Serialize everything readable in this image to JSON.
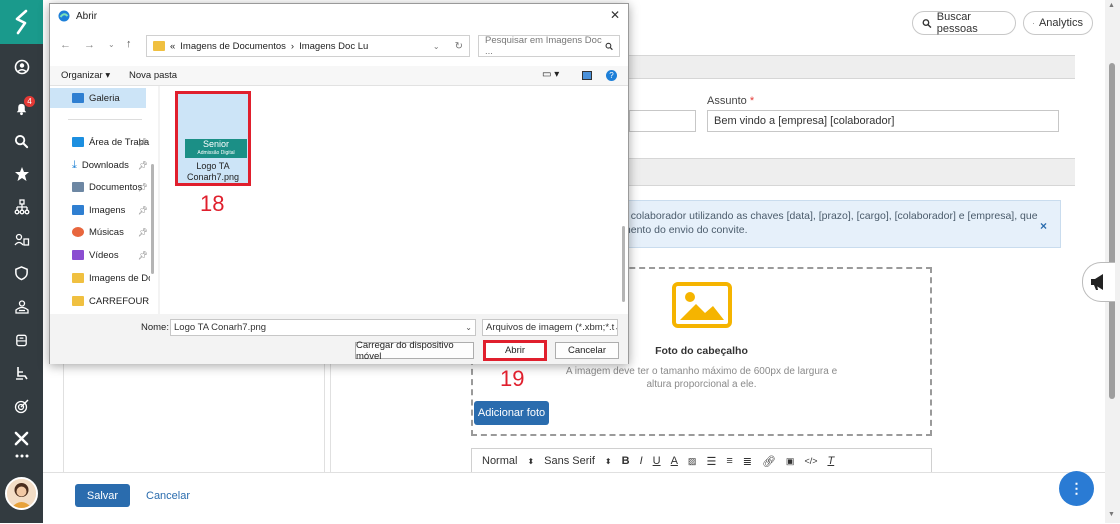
{
  "topbar": {
    "search_people": "Buscar pessoas",
    "analytics": "Analytics"
  },
  "sidebar": {
    "notification_count": "4"
  },
  "form": {
    "subject_label": "Assunto",
    "required_mark": "*",
    "subject_value": "Bem vindo a [empresa] [colaborador]",
    "info_line1": "o colaborador utilizando as chaves [data], [prazo], [cargo], [colaborador] e [empresa], que",
    "info_line2": "mento do envio do convite.",
    "header_photo_title": "Foto do cabeçalho",
    "header_photo_desc": "A imagem deve ter o tamanho máximo de 600px de largura e altura proporcional a ele.",
    "add_photo": "Adicionar foto",
    "editor_format": "Normal",
    "editor_font": "Sans Serif"
  },
  "footer": {
    "save": "Salvar",
    "cancel": "Cancelar"
  },
  "dialog": {
    "title": "Abrir",
    "breadcrumb_prefix": "«",
    "breadcrumb_1": "Imagens de Documentos",
    "breadcrumb_sep": "›",
    "breadcrumb_2": "Imagens Doc Lu",
    "search_placeholder": "Pesquisar em Imagens Doc ...",
    "organize": "Organizar",
    "new_folder": "Nova pasta",
    "nav_items": [
      {
        "label": "Galeria",
        "color": "#2f7fd1"
      },
      {
        "label": "Área de Traba",
        "color": "#1c8fe0"
      },
      {
        "label": "Downloads",
        "color": "#1a7fd4"
      },
      {
        "label": "Documentos",
        "color": "#6d87a3"
      },
      {
        "label": "Imagens",
        "color": "#2f7fd1"
      },
      {
        "label": "Músicas",
        "color": "#e8663d"
      },
      {
        "label": "Vídeos",
        "color": "#8b4dd1"
      },
      {
        "label": "Imagens de Doc",
        "color": "#f0c040"
      },
      {
        "label": "CARREFOUR",
        "color": "#f0c040"
      }
    ],
    "file": {
      "name_line1": "Logo TA",
      "name_line2": "Conarh7.png",
      "logo_text": "Senior",
      "logo_sub": "Admissão Digital"
    },
    "name_label": "Nome:",
    "name_value": "Logo TA Conarh7.png",
    "filetype": "Arquivos de imagem (*.xbm;*.t",
    "upload_from_device": "Carregar do dispositivo móvel",
    "open": "Abrir",
    "cancel": "Cancelar"
  },
  "annotations": {
    "step_18": "18",
    "step_19": "19"
  },
  "colors": {
    "accent_teal": "#1a9a8c",
    "sidebar_bg": "#333b40",
    "primary_button": "#2a6cae",
    "highlight_red": "#e01f2d",
    "image_icon_yellow": "#f5b400"
  }
}
